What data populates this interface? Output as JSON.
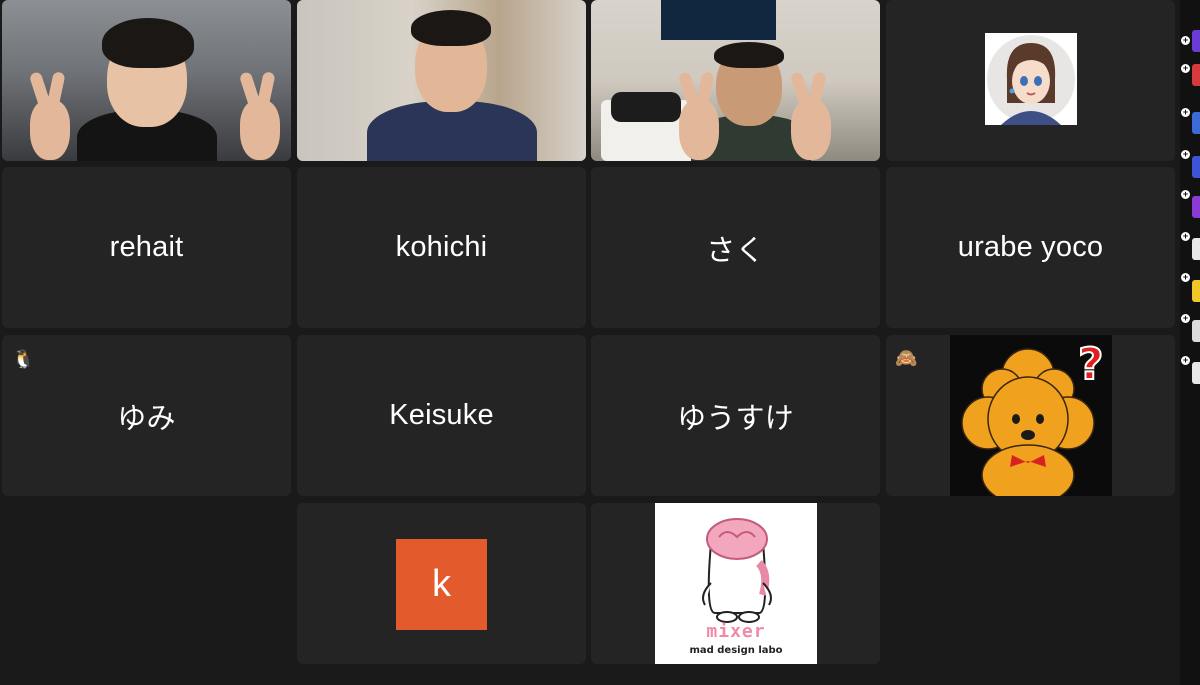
{
  "participants": {
    "row2": [
      "rehait",
      "kohichi",
      "さく",
      "urabe yoco"
    ],
    "row3": [
      "ゆみ",
      "Keisuke",
      "ゆうすけ"
    ]
  },
  "tiles": {
    "k_avatar": {
      "letter": "k",
      "color": "#e35a2c"
    },
    "mixer_logo": {
      "title": "mixer",
      "subtitle": "mad design labo"
    }
  },
  "emoji_badges": {
    "yumi": "🐧",
    "dog_tile": "🙈"
  },
  "colors": {
    "speaking_border": "#4fd34b",
    "tile_bg": "#242424",
    "page_bg": "#1a1a1a"
  },
  "sidebar": {
    "items": [
      "purple",
      "red",
      "blue",
      "blue",
      "purple",
      "white",
      "yellow",
      "white",
      "white"
    ]
  }
}
